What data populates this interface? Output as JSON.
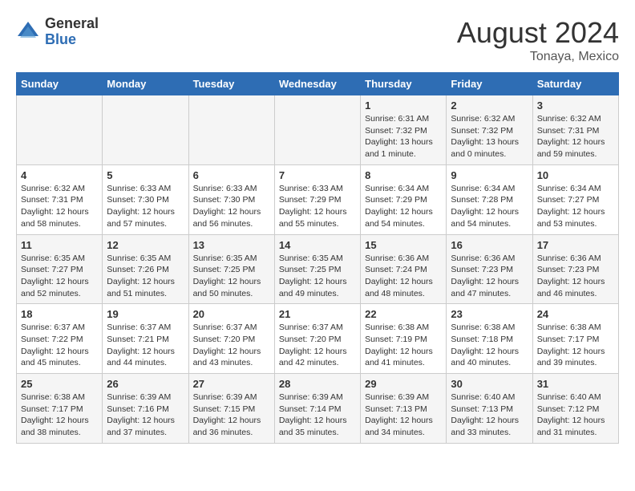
{
  "header": {
    "logo_general": "General",
    "logo_blue": "Blue",
    "month_year": "August 2024",
    "location": "Tonaya, Mexico"
  },
  "days_of_week": [
    "Sunday",
    "Monday",
    "Tuesday",
    "Wednesday",
    "Thursday",
    "Friday",
    "Saturday"
  ],
  "weeks": [
    [
      {
        "day": "",
        "info": ""
      },
      {
        "day": "",
        "info": ""
      },
      {
        "day": "",
        "info": ""
      },
      {
        "day": "",
        "info": ""
      },
      {
        "day": "1",
        "info": "Sunrise: 6:31 AM\nSunset: 7:32 PM\nDaylight: 13 hours\nand 1 minute."
      },
      {
        "day": "2",
        "info": "Sunrise: 6:32 AM\nSunset: 7:32 PM\nDaylight: 13 hours\nand 0 minutes."
      },
      {
        "day": "3",
        "info": "Sunrise: 6:32 AM\nSunset: 7:31 PM\nDaylight: 12 hours\nand 59 minutes."
      }
    ],
    [
      {
        "day": "4",
        "info": "Sunrise: 6:32 AM\nSunset: 7:31 PM\nDaylight: 12 hours\nand 58 minutes."
      },
      {
        "day": "5",
        "info": "Sunrise: 6:33 AM\nSunset: 7:30 PM\nDaylight: 12 hours\nand 57 minutes."
      },
      {
        "day": "6",
        "info": "Sunrise: 6:33 AM\nSunset: 7:30 PM\nDaylight: 12 hours\nand 56 minutes."
      },
      {
        "day": "7",
        "info": "Sunrise: 6:33 AM\nSunset: 7:29 PM\nDaylight: 12 hours\nand 55 minutes."
      },
      {
        "day": "8",
        "info": "Sunrise: 6:34 AM\nSunset: 7:29 PM\nDaylight: 12 hours\nand 54 minutes."
      },
      {
        "day": "9",
        "info": "Sunrise: 6:34 AM\nSunset: 7:28 PM\nDaylight: 12 hours\nand 54 minutes."
      },
      {
        "day": "10",
        "info": "Sunrise: 6:34 AM\nSunset: 7:27 PM\nDaylight: 12 hours\nand 53 minutes."
      }
    ],
    [
      {
        "day": "11",
        "info": "Sunrise: 6:35 AM\nSunset: 7:27 PM\nDaylight: 12 hours\nand 52 minutes."
      },
      {
        "day": "12",
        "info": "Sunrise: 6:35 AM\nSunset: 7:26 PM\nDaylight: 12 hours\nand 51 minutes."
      },
      {
        "day": "13",
        "info": "Sunrise: 6:35 AM\nSunset: 7:25 PM\nDaylight: 12 hours\nand 50 minutes."
      },
      {
        "day": "14",
        "info": "Sunrise: 6:35 AM\nSunset: 7:25 PM\nDaylight: 12 hours\nand 49 minutes."
      },
      {
        "day": "15",
        "info": "Sunrise: 6:36 AM\nSunset: 7:24 PM\nDaylight: 12 hours\nand 48 minutes."
      },
      {
        "day": "16",
        "info": "Sunrise: 6:36 AM\nSunset: 7:23 PM\nDaylight: 12 hours\nand 47 minutes."
      },
      {
        "day": "17",
        "info": "Sunrise: 6:36 AM\nSunset: 7:23 PM\nDaylight: 12 hours\nand 46 minutes."
      }
    ],
    [
      {
        "day": "18",
        "info": "Sunrise: 6:37 AM\nSunset: 7:22 PM\nDaylight: 12 hours\nand 45 minutes."
      },
      {
        "day": "19",
        "info": "Sunrise: 6:37 AM\nSunset: 7:21 PM\nDaylight: 12 hours\nand 44 minutes."
      },
      {
        "day": "20",
        "info": "Sunrise: 6:37 AM\nSunset: 7:20 PM\nDaylight: 12 hours\nand 43 minutes."
      },
      {
        "day": "21",
        "info": "Sunrise: 6:37 AM\nSunset: 7:20 PM\nDaylight: 12 hours\nand 42 minutes."
      },
      {
        "day": "22",
        "info": "Sunrise: 6:38 AM\nSunset: 7:19 PM\nDaylight: 12 hours\nand 41 minutes."
      },
      {
        "day": "23",
        "info": "Sunrise: 6:38 AM\nSunset: 7:18 PM\nDaylight: 12 hours\nand 40 minutes."
      },
      {
        "day": "24",
        "info": "Sunrise: 6:38 AM\nSunset: 7:17 PM\nDaylight: 12 hours\nand 39 minutes."
      }
    ],
    [
      {
        "day": "25",
        "info": "Sunrise: 6:38 AM\nSunset: 7:17 PM\nDaylight: 12 hours\nand 38 minutes."
      },
      {
        "day": "26",
        "info": "Sunrise: 6:39 AM\nSunset: 7:16 PM\nDaylight: 12 hours\nand 37 minutes."
      },
      {
        "day": "27",
        "info": "Sunrise: 6:39 AM\nSunset: 7:15 PM\nDaylight: 12 hours\nand 36 minutes."
      },
      {
        "day": "28",
        "info": "Sunrise: 6:39 AM\nSunset: 7:14 PM\nDaylight: 12 hours\nand 35 minutes."
      },
      {
        "day": "29",
        "info": "Sunrise: 6:39 AM\nSunset: 7:13 PM\nDaylight: 12 hours\nand 34 minutes."
      },
      {
        "day": "30",
        "info": "Sunrise: 6:40 AM\nSunset: 7:13 PM\nDaylight: 12 hours\nand 33 minutes."
      },
      {
        "day": "31",
        "info": "Sunrise: 6:40 AM\nSunset: 7:12 PM\nDaylight: 12 hours\nand 31 minutes."
      }
    ]
  ]
}
